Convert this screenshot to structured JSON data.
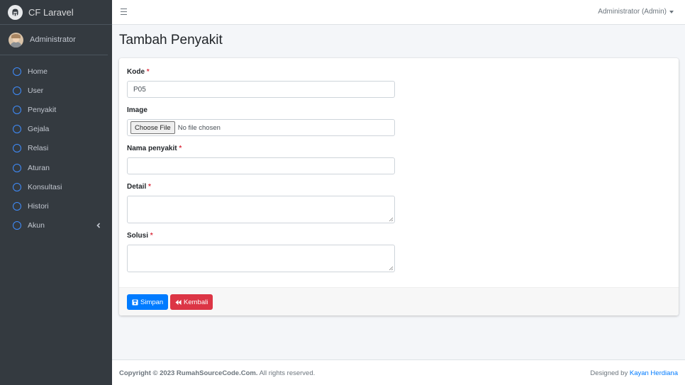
{
  "brand": {
    "name": "CF Laravel"
  },
  "user_panel": {
    "name": "Administrator"
  },
  "sidebar": {
    "items": [
      {
        "label": "Home"
      },
      {
        "label": "User"
      },
      {
        "label": "Penyakit"
      },
      {
        "label": "Gejala"
      },
      {
        "label": "Relasi"
      },
      {
        "label": "Aturan"
      },
      {
        "label": "Konsultasi"
      },
      {
        "label": "Histori"
      },
      {
        "label": "Akun"
      }
    ]
  },
  "topbar": {
    "user_menu": "Administrator (Admin)"
  },
  "page": {
    "title": "Tambah Penyakit"
  },
  "form": {
    "kode": {
      "label": "Kode",
      "required": "*",
      "value": "P05"
    },
    "image": {
      "label": "Image",
      "button": "Choose File",
      "status": "No file chosen"
    },
    "nama": {
      "label": "Nama penyakit",
      "required": "*",
      "value": ""
    },
    "detail": {
      "label": "Detail",
      "required": "*"
    },
    "solusi": {
      "label": "Solusi",
      "required": "*"
    },
    "save_label": "Simpan",
    "back_label": "Kembali"
  },
  "footer": {
    "copyright_prefix": "Copyright © 2023 ",
    "site": "RumahSourceCode.Com.",
    "rights": " All rights reserved.",
    "designed_by": "Designed by ",
    "author": "Kayan Herdiana"
  },
  "colors": {
    "sidebar_bg": "#343a40",
    "primary": "#007bff",
    "danger": "#dc3545",
    "nav_icon": "#3f8dfd"
  }
}
